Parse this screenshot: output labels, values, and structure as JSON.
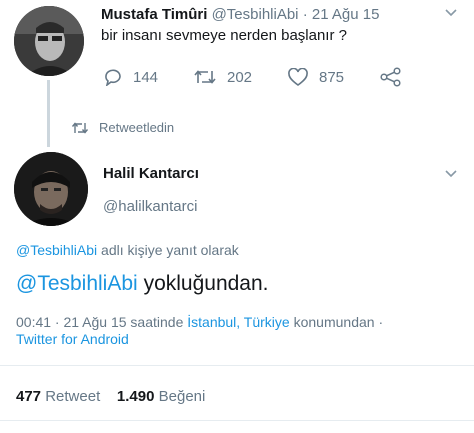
{
  "tweet1": {
    "name": "Mustafa Timûri",
    "handle": "@TesbihliAbi",
    "separator": "·",
    "date": "21 Ağu 15",
    "text": "bir insanı sevmeye nerden başlanır ?",
    "actions": {
      "replies": "144",
      "retweets": "202",
      "likes": "875"
    },
    "retweeted_label": "Retweetledin"
  },
  "tweet2": {
    "name": "Halil Kantarcı",
    "handle": "@halilkantarci",
    "reply_to_handle": "@TesbihliAbi",
    "reply_to_suffix": "adlı kişiye yanıt olarak",
    "text_mention": "@TesbihliAbi",
    "text_body": "yokluğundan.",
    "meta_time": "00:41 · 21 Ağu 15 saatinde",
    "meta_location": "İstanbul, Türkiye",
    "meta_suffix": "konumundan ·",
    "meta_client": "Twitter for Android",
    "stats": {
      "retweet_count": "477",
      "retweet_label": "Retweet",
      "like_count": "1.490",
      "like_label": "Beğeni"
    }
  },
  "colors": {
    "link": "#1b95e0",
    "muted": "#657786",
    "text": "#14171a"
  },
  "icons": [
    "reply-icon",
    "retweet-icon",
    "like-icon",
    "share-icon",
    "chevron-down-icon",
    "retweeted-icon"
  ]
}
